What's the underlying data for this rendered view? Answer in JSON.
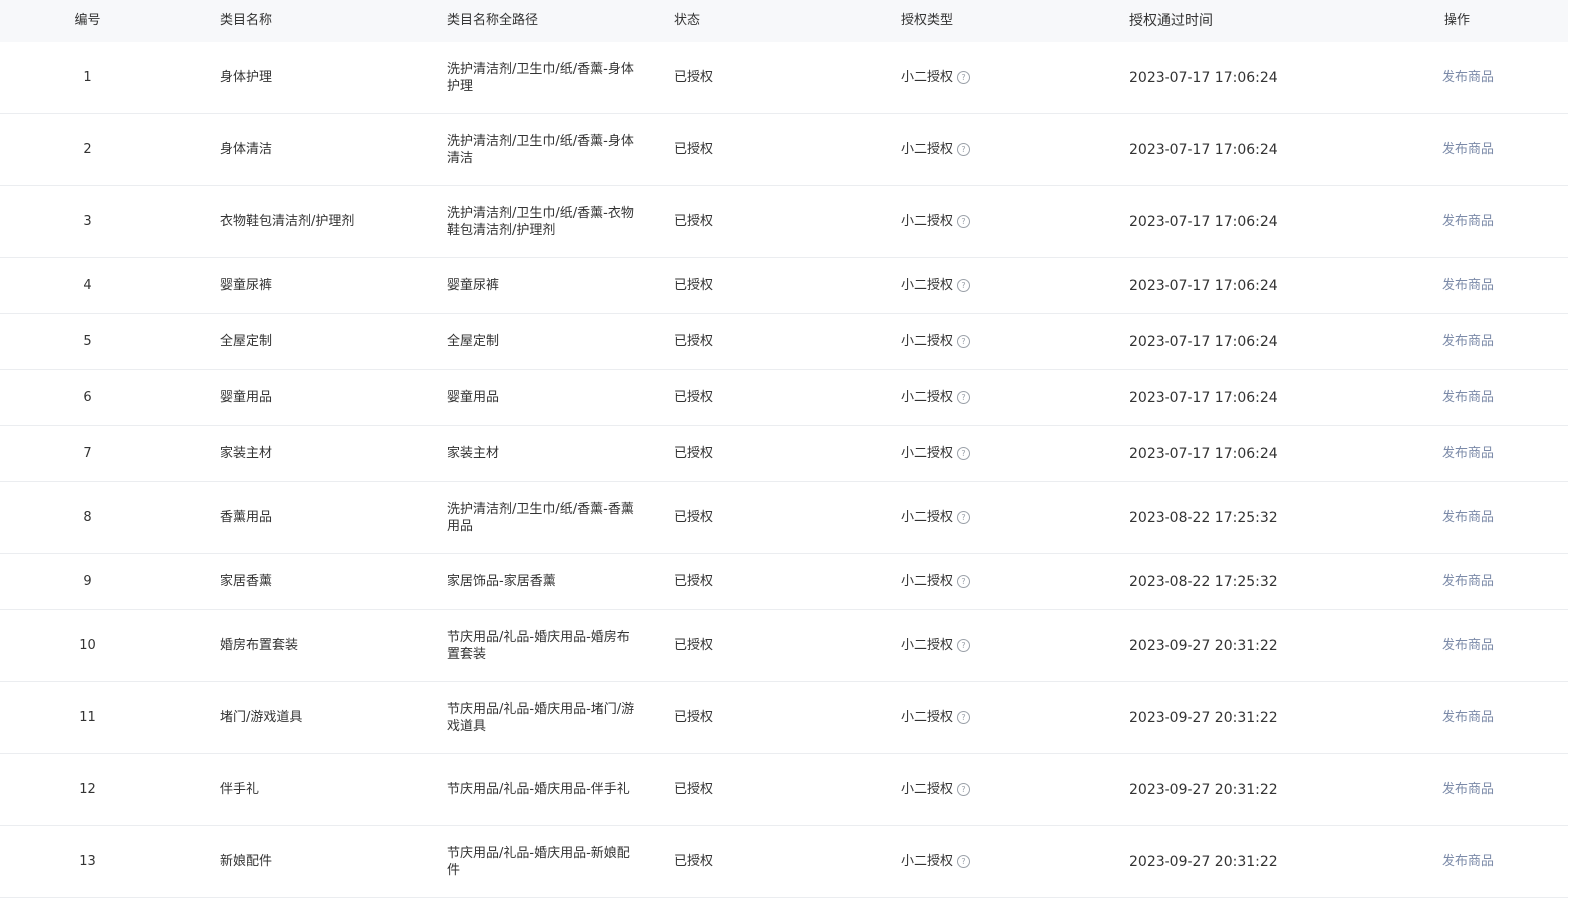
{
  "headers": {
    "num": "编号",
    "name": "类目名称",
    "path": "类目名称全路径",
    "status": "状态",
    "type": "授权类型",
    "time": "授权通过时间",
    "op": "操作"
  },
  "icons": {
    "help": "question-circle-icon"
  },
  "colors": {
    "header_bg": "#f7f8fa",
    "link": "#7b8aa8",
    "divider": "#ebedf0"
  },
  "rows": [
    {
      "num": "1",
      "name": "身体护理",
      "path": "洗护清洁剂/卫生巾/纸/香薰-身体护理",
      "status": "已授权",
      "type": "小二授权",
      "time": "2023-07-17 17:06:24",
      "op": "发布商品"
    },
    {
      "num": "2",
      "name": "身体清洁",
      "path": "洗护清洁剂/卫生巾/纸/香薰-身体清洁",
      "status": "已授权",
      "type": "小二授权",
      "time": "2023-07-17 17:06:24",
      "op": "发布商品"
    },
    {
      "num": "3",
      "name": "衣物鞋包清洁剂/护理剂",
      "path": "洗护清洁剂/卫生巾/纸/香薰-衣物鞋包清洁剂/护理剂",
      "status": "已授权",
      "type": "小二授权",
      "time": "2023-07-17 17:06:24",
      "op": "发布商品"
    },
    {
      "num": "4",
      "name": "婴童尿裤",
      "path": "婴童尿裤",
      "status": "已授权",
      "type": "小二授权",
      "time": "2023-07-17 17:06:24",
      "op": "发布商品"
    },
    {
      "num": "5",
      "name": "全屋定制",
      "path": "全屋定制",
      "status": "已授权",
      "type": "小二授权",
      "time": "2023-07-17 17:06:24",
      "op": "发布商品"
    },
    {
      "num": "6",
      "name": "婴童用品",
      "path": "婴童用品",
      "status": "已授权",
      "type": "小二授权",
      "time": "2023-07-17 17:06:24",
      "op": "发布商品"
    },
    {
      "num": "7",
      "name": "家装主材",
      "path": "家装主材",
      "status": "已授权",
      "type": "小二授权",
      "time": "2023-07-17 17:06:24",
      "op": "发布商品"
    },
    {
      "num": "8",
      "name": "香薰用品",
      "path": "洗护清洁剂/卫生巾/纸/香薰-香薰用品",
      "status": "已授权",
      "type": "小二授权",
      "time": "2023-08-22 17:25:32",
      "op": "发布商品"
    },
    {
      "num": "9",
      "name": "家居香薰",
      "path": "家居饰品-家居香薰",
      "status": "已授权",
      "type": "小二授权",
      "time": "2023-08-22 17:25:32",
      "op": "发布商品"
    },
    {
      "num": "10",
      "name": "婚房布置套装",
      "path": "节庆用品/礼品-婚庆用品-婚房布置套装",
      "status": "已授权",
      "type": "小二授权",
      "time": "2023-09-27 20:31:22",
      "op": "发布商品"
    },
    {
      "num": "11",
      "name": "堵门/游戏道具",
      "path": "节庆用品/礼品-婚庆用品-堵门/游戏道具",
      "status": "已授权",
      "type": "小二授权",
      "time": "2023-09-27 20:31:22",
      "op": "发布商品"
    },
    {
      "num": "12",
      "name": "伴手礼",
      "path": "节庆用品/礼品-婚庆用品-伴手礼",
      "status": "已授权",
      "type": "小二授权",
      "time": "2023-09-27 20:31:22",
      "op": "发布商品"
    },
    {
      "num": "13",
      "name": "新娘配件",
      "path": "节庆用品/礼品-婚庆用品-新娘配件",
      "status": "已授权",
      "type": "小二授权",
      "time": "2023-09-27 20:31:22",
      "op": "发布商品"
    }
  ]
}
